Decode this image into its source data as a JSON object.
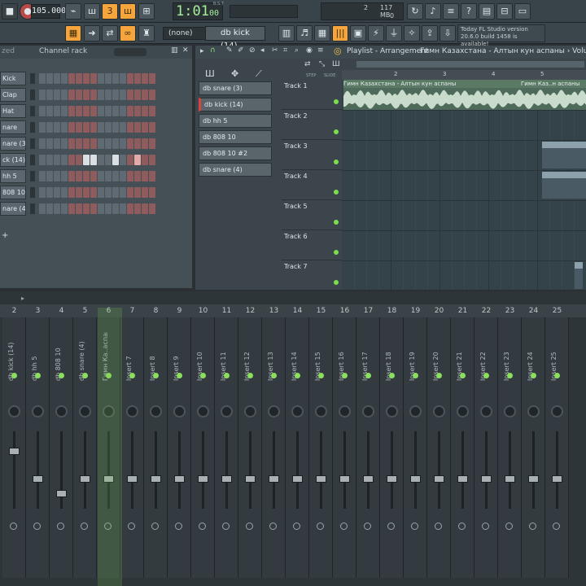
{
  "toolbar": {
    "tempo": "105.000",
    "time": "1:01",
    "time_sub": "00",
    "time_unit": "B:S:T",
    "cpu_num": "2",
    "mem": "117 MB",
    "mem_zero": "0",
    "pattern_selector": "db kick (14)",
    "none_select": "(none)",
    "news_date": "Today",
    "news_line1": "FL Studio version",
    "news_line2": "20.6.0 build 1458 is available!"
  },
  "channel_rack": {
    "title": "Channel rack",
    "left_label": "zed",
    "channels": [
      {
        "label": "Kick",
        "steps": "RRRRRRRRRRRRRRRR"
      },
      {
        "label": "Clap",
        "steps": "RRRRRRRRRRRRRRRR"
      },
      {
        "label": "Hat",
        "steps": "RRRRRRRRRRRRRRRR"
      },
      {
        "label": "nare",
        "steps": "RRRRRRRRRRRRRRRR"
      },
      {
        "label": "nare (3)",
        "steps": "RRRRRRRRRRRRRRRR"
      },
      {
        "label": "ck (14)",
        "steps": "RRRRRRWWRRWRRPRR"
      },
      {
        "label": "hh 5",
        "steps": "RRRRRRRRRRRRRRRR"
      },
      {
        "label": "808 10",
        "steps": "RRRRRRRRRRRRRRRR"
      },
      {
        "label": "nare (4)",
        "steps": "RRRRRRRRRRRRRRRR"
      }
    ]
  },
  "patterns": [
    "db snare (3)",
    "db kick (14)",
    "db hh 5",
    "db 808 10",
    "db 808 10 #2",
    "db snare (4)"
  ],
  "playlist": {
    "title": "Playlist - Arrangement",
    "clip_name": "Гимн Казахстана - Алтын кун аспаны",
    "breadcrumb": "Гимн Казахстана - Алтын кун аспаны › Volume",
    "clip_label_short": "Гимн Каз..н аспаны",
    "ruler": [
      "2",
      "3",
      "4",
      "5"
    ],
    "tracks": [
      "Track 1",
      "Track 2",
      "Track 3",
      "Track 4",
      "Track 5",
      "Track 6",
      "Track 7"
    ],
    "step_label": "STEP",
    "slide_label": "SLIDE"
  },
  "mixer": {
    "numbers": [
      "2",
      "3",
      "4",
      "5",
      "6",
      "7",
      "8",
      "9",
      "10",
      "11",
      "12",
      "13",
      "14",
      "15",
      "16",
      "17",
      "18",
      "19",
      "20",
      "21",
      "22",
      "23",
      "24",
      "25"
    ],
    "strips": [
      {
        "name": "db kick (14)",
        "fader": 0.78
      },
      {
        "name": "db hh 5",
        "fader": 0.4
      },
      {
        "name": "db 808 10",
        "fader": 0.2
      },
      {
        "name": "db snare (4)",
        "fader": 0.4
      },
      {
        "name": "Гимн Ка..аспаны",
        "fader": 0.4
      },
      {
        "name": "Insert 7",
        "fader": 0.4
      },
      {
        "name": "Insert 8",
        "fader": 0.4
      },
      {
        "name": "Insert 9",
        "fader": 0.4
      },
      {
        "name": "Insert 10",
        "fader": 0.4
      },
      {
        "name": "Insert 11",
        "fader": 0.4
      },
      {
        "name": "Insert 12",
        "fader": 0.4
      },
      {
        "name": "Insert 13",
        "fader": 0.4
      },
      {
        "name": "Insert 14",
        "fader": 0.4
      },
      {
        "name": "Insert 15",
        "fader": 0.4
      },
      {
        "name": "Insert 16",
        "fader": 0.4
      },
      {
        "name": "Insert 17",
        "fader": 0.4
      },
      {
        "name": "Insert 18",
        "fader": 0.4
      },
      {
        "name": "Insert 19",
        "fader": 0.4
      },
      {
        "name": "Insert 20",
        "fader": 0.4
      },
      {
        "name": "Insert 21",
        "fader": 0.4
      },
      {
        "name": "Insert 22",
        "fader": 0.4
      },
      {
        "name": "Insert 23",
        "fader": 0.4
      },
      {
        "name": "Insert 24",
        "fader": 0.4
      },
      {
        "name": "Insert 25",
        "fader": 0.4
      }
    ]
  },
  "colors": {
    "accent": "#f5a53c",
    "led": "#8ae05c",
    "selected_strip": "#3f5a2e"
  }
}
